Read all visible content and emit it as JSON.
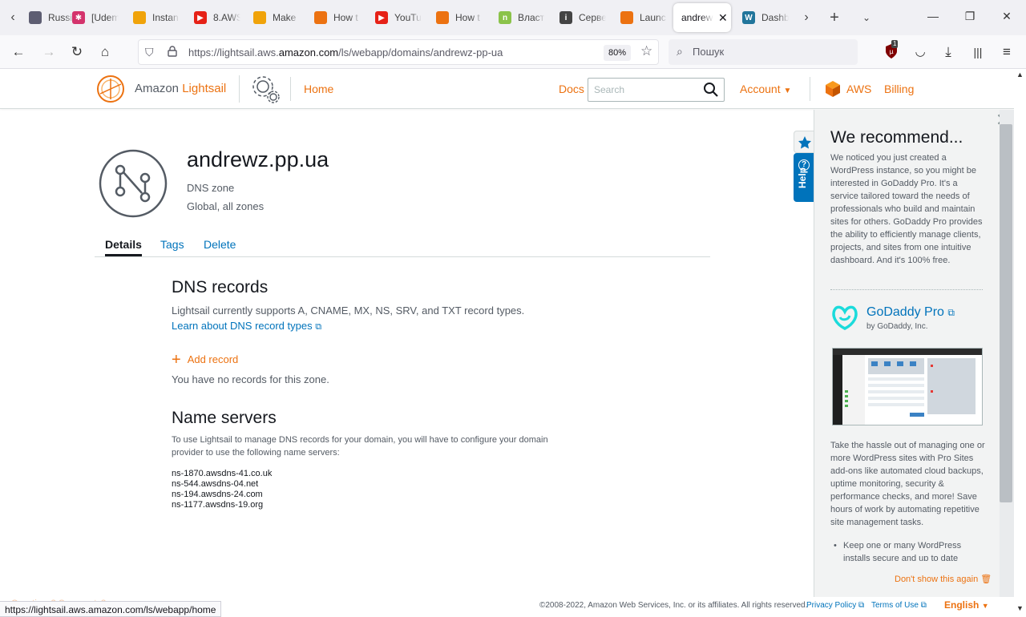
{
  "browser": {
    "tabs": [
      {
        "label": "Russia",
        "color": "#5e5e72",
        "glyph": ""
      },
      {
        "label": "[Udem",
        "color": "#d4336c",
        "glyph": "✱"
      },
      {
        "label": "Instan",
        "color": "#f0a30a",
        "glyph": ""
      },
      {
        "label": "8.AWS",
        "color": "#e62117",
        "glyph": "▶"
      },
      {
        "label": "Make",
        "color": "#f0a30a",
        "glyph": ""
      },
      {
        "label": "How t",
        "color": "#ec7211",
        "glyph": ""
      },
      {
        "label": "YouTu",
        "color": "#e62117",
        "glyph": "▶"
      },
      {
        "label": "How t",
        "color": "#ec7211",
        "glyph": ""
      },
      {
        "label": "Власт",
        "color": "#8bc34a",
        "glyph": "n"
      },
      {
        "label": "Серве",
        "color": "#444444",
        "glyph": "i"
      },
      {
        "label": "Launc",
        "color": "#ec7211",
        "glyph": ""
      },
      {
        "label": "andrew",
        "color": "",
        "glyph": "",
        "active": true
      },
      {
        "label": "Dashb",
        "color": "#21759b",
        "glyph": "W"
      }
    ],
    "url_prefix": "https://lightsail.aws.",
    "url_domain": "amazon.com",
    "url_path": "/ls/webapp/domains/andrewz-pp-ua",
    "zoom": "80%",
    "search_placeholder": "Пошук",
    "extension_badge": "1",
    "status_url": "https://lightsail.aws.amazon.com/ls/webapp/home",
    "status_ghost": "Questions? Comments?"
  },
  "header": {
    "brand_prefix": "Amazon",
    "brand_name": "Lightsail",
    "home": "Home",
    "docs": "Docs",
    "search_placeholder": "Search",
    "account": "Account",
    "aws": "AWS",
    "billing": "Billing"
  },
  "zone": {
    "title": "andrewz.pp.ua",
    "type": "DNS zone",
    "scope": "Global, all zones"
  },
  "content_tabs": [
    "Details",
    "Tags",
    "Delete"
  ],
  "dns": {
    "title": "DNS records",
    "description": "Lightsail currently supports A, CNAME, MX, NS, SRV, and TXT record types.",
    "learn_link": "Learn about DNS record types",
    "add_record": "Add record",
    "empty": "You have no records for this zone."
  },
  "name_servers": {
    "title": "Name servers",
    "description": "To use Lightsail to manage DNS records for your domain, you will have to configure your domain provider to use the following name servers:",
    "servers": [
      "ns-1870.awsdns-41.co.uk",
      "ns-544.awsdns-04.net",
      "ns-194.awsdns-24.com",
      "ns-1177.awsdns-19.org"
    ]
  },
  "panel": {
    "title": "We recommend...",
    "intro": "We noticed you just created a WordPress instance, so you might be interested in GoDaddy Pro. It's a service tailored toward the needs of professionals who build and maintain sites for others. GoDaddy Pro provides the ability to efficiently manage clients, projects, and sites from one intuitive dashboard. And it's 100% free.",
    "product": "GoDaddy Pro",
    "by": "by GoDaddy, Inc.",
    "body": "Take the hassle out of managing one or more WordPress sites with Pro Sites add-ons like automated cloud backups, uptime monitoring, security & performance checks, and more! Save hours of work by automating repetitive site management tasks.",
    "bullet": "Keep one or many WordPress installs secure and up to date",
    "dont_show": "Don't show this again",
    "help_label": "Help"
  },
  "footer": {
    "copyright": "©2008-2022, Amazon Web Services, Inc. or its affiliates. All rights reserved.",
    "privacy": "Privacy Policy",
    "terms": "Terms of Use",
    "language": "English"
  },
  "colors": {
    "accent": "#ec7211",
    "link": "#0073bb",
    "text": "#16191f"
  }
}
